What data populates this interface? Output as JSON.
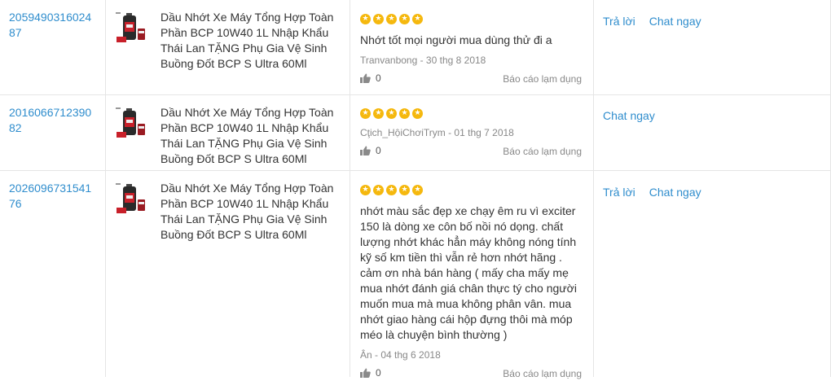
{
  "rows": [
    {
      "order_id": "205949031602487",
      "product_name": "Dầu Nhớt Xe Máy Tổng Hợp Toàn Phần BCP 10W40 1L Nhập Khẩu Thái Lan TẶNG Phụ Gia Vệ Sinh Buồng Đốt BCP S Ultra 60Ml",
      "rating": 5,
      "comment": "Nhớt tốt mọi người mua dùng thử đi a",
      "meta": "Tranvanbong - 30 thg 8 2018",
      "likes": "0",
      "report": "Báo cáo lạm dụng",
      "reply": "Trả lời",
      "chat": "Chat ngay"
    },
    {
      "order_id": "201606671239082",
      "product_name": "Dầu Nhớt Xe Máy Tổng Hợp Toàn Phần BCP 10W40 1L Nhập Khẩu Thái Lan TẶNG Phụ Gia Vệ Sinh Buồng Đốt BCP S Ultra 60Ml",
      "rating": 5,
      "comment": "",
      "meta": "Cţich_HộiChơiTrym - 01 thg 7 2018",
      "likes": "0",
      "report": "Báo cáo lạm dụng",
      "reply": "",
      "chat": "Chat ngay"
    },
    {
      "order_id": "202609673154176",
      "product_name": "Dầu Nhớt Xe Máy Tổng Hợp Toàn Phần BCP 10W40 1L Nhập Khẩu Thái Lan TẶNG Phụ Gia Vệ Sinh Buồng Đốt BCP S Ultra 60Ml",
      "rating": 5,
      "comment": "nhớt màu sắc đẹp xe chạy êm ru vì exciter 150 là dòng xe côn bố nồi nó dọng. chất lượng nhớt khác hẳn máy không nóng tính kỹ số km tiền thì vẫn rẻ hơn nhớt hãng . cảm ơn nhà bán hàng ( mấy cha mấy mẹ mua nhớt đánh giá chân thực tý cho người muốn mua mà mua không phân vân. mua nhớt giao hàng cái hộp đựng thôi mà móp méo là chuyện bình thường )",
      "meta": "Ân - 04 thg 6 2018",
      "likes": "0",
      "report": "Báo cáo lạm dụng",
      "reply": "Trả lời",
      "chat": "Chat ngay"
    }
  ],
  "colors": {
    "link": "#2f8dcd",
    "star": "#f5b80e",
    "border": "#e5e5e5",
    "muted": "#888888"
  },
  "icons": {
    "like": "thumbs-up-icon",
    "star": "star-icon"
  }
}
